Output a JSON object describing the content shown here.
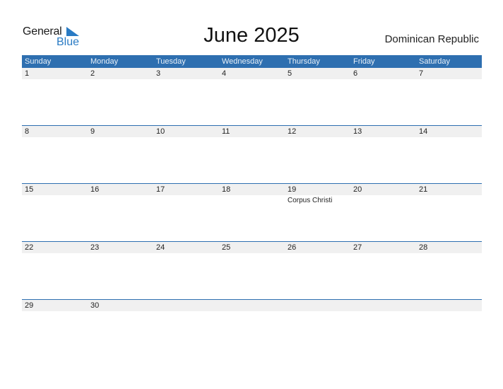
{
  "logo": {
    "line1": "General",
    "line2": "Blue"
  },
  "title": "June 2025",
  "country": "Dominican Republic",
  "colors": {
    "header": "#2e6fb0",
    "logo_blue": "#2a7bc4",
    "day_row": "#f0f0f0"
  },
  "weekdays": [
    "Sunday",
    "Monday",
    "Tuesday",
    "Wednesday",
    "Thursday",
    "Friday",
    "Saturday"
  ],
  "weeks": [
    {
      "days": [
        "1",
        "2",
        "3",
        "4",
        "5",
        "6",
        "7"
      ],
      "events": [
        "",
        "",
        "",
        "",
        "",
        "",
        ""
      ]
    },
    {
      "days": [
        "8",
        "9",
        "10",
        "11",
        "12",
        "13",
        "14"
      ],
      "events": [
        "",
        "",
        "",
        "",
        "",
        "",
        ""
      ]
    },
    {
      "days": [
        "15",
        "16",
        "17",
        "18",
        "19",
        "20",
        "21"
      ],
      "events": [
        "",
        "",
        "",
        "",
        "Corpus Christi",
        "",
        ""
      ]
    },
    {
      "days": [
        "22",
        "23",
        "24",
        "25",
        "26",
        "27",
        "28"
      ],
      "events": [
        "",
        "",
        "",
        "",
        "",
        "",
        ""
      ]
    },
    {
      "days": [
        "29",
        "30",
        "",
        "",
        "",
        "",
        ""
      ],
      "events": [
        "",
        "",
        "",
        "",
        "",
        "",
        ""
      ]
    }
  ]
}
